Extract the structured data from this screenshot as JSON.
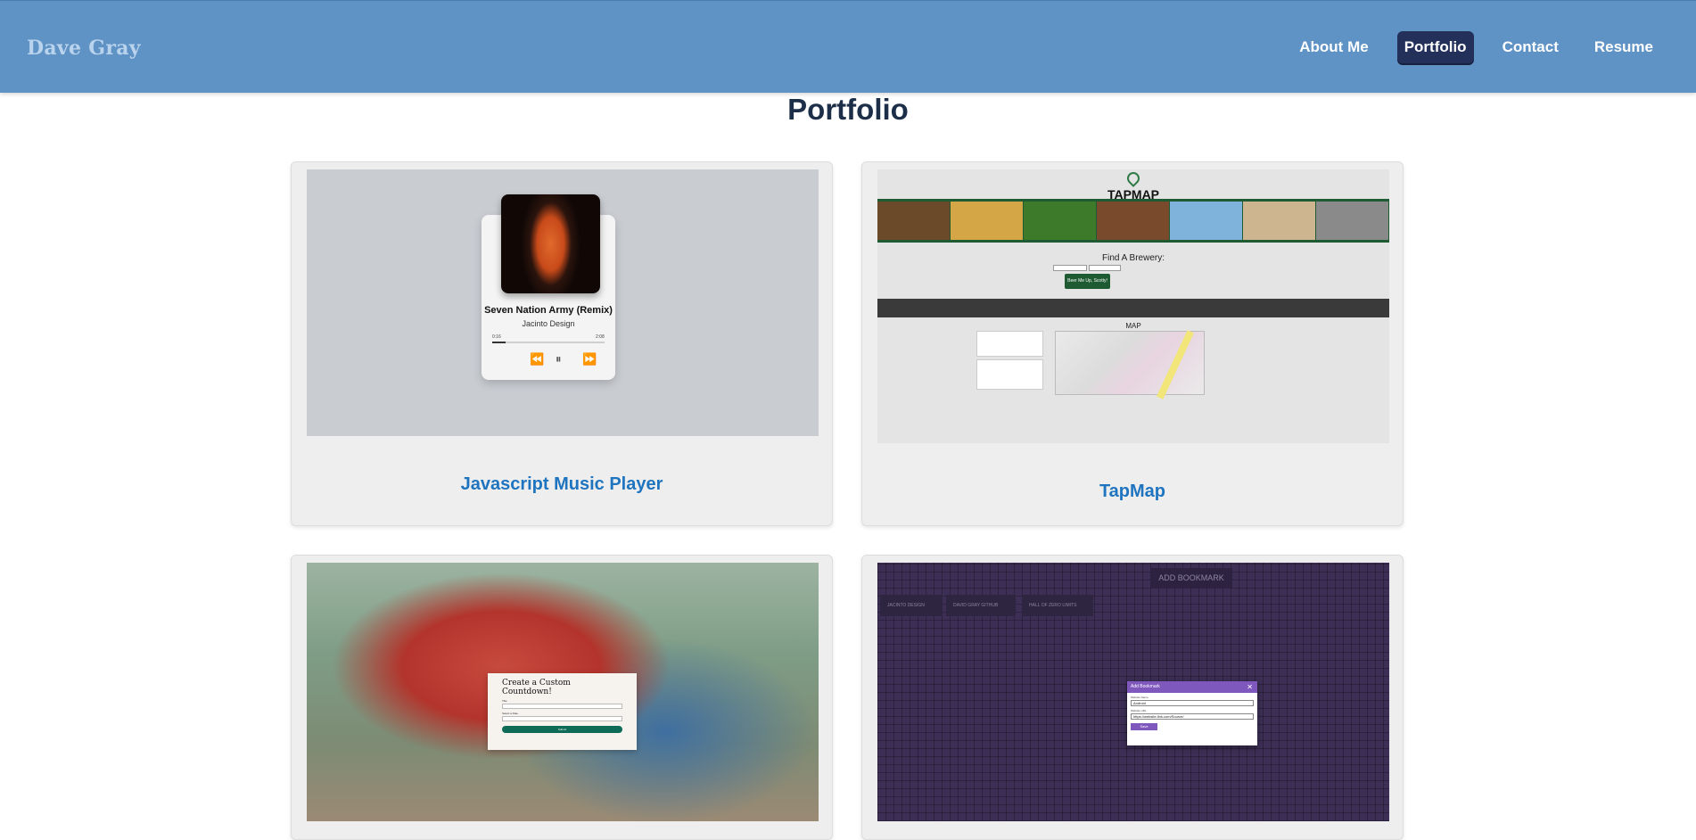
{
  "nav": {
    "brand": "Dave Gray",
    "links": [
      {
        "label": "About Me",
        "active": false
      },
      {
        "label": "Portfolio",
        "active": true
      },
      {
        "label": "Contact",
        "active": false
      },
      {
        "label": "Resume",
        "active": false
      }
    ]
  },
  "page": {
    "title": "Portfolio"
  },
  "colors": {
    "navbar": "#5f92c5",
    "active_link": "#22305a",
    "card_title": "#1f74bf",
    "title": "#1d2f48"
  },
  "projects": [
    {
      "title": "Javascript Music Player",
      "thumb": {
        "song": "Seven Nation Army (Remix)",
        "artist": "Jacinto Design",
        "time_current": "0:16",
        "time_total": "2:08",
        "progress": 0.12,
        "controls": [
          "rewind-icon",
          "pause-icon",
          "forward-icon"
        ]
      }
    },
    {
      "title": "TapMap",
      "thumb": {
        "logo": "TAPMAP",
        "find_label": "Find A Brewery:",
        "button": "Beer Me Up, Scotty!",
        "map_label": "MAP"
      }
    },
    {
      "title": "",
      "thumb": {
        "heading": "Create a Custom Countdown!",
        "title_label": "Title",
        "date_label": "Select a Date",
        "submit": "Submit"
      }
    },
    {
      "title": "",
      "thumb": {
        "add_button": "ADD BOOKMARK",
        "bookmarks": [
          "JACINTO DESIGN",
          "DAVID GRAY GITHUB",
          "HALL OF ZERO LIMITS"
        ],
        "modal_title": "Add Bookmark",
        "name_label": "Website Name",
        "name_value": "Android",
        "url_label": "Website URL",
        "url_value": "https://website-link.com/Source/",
        "save": "Save"
      }
    }
  ]
}
